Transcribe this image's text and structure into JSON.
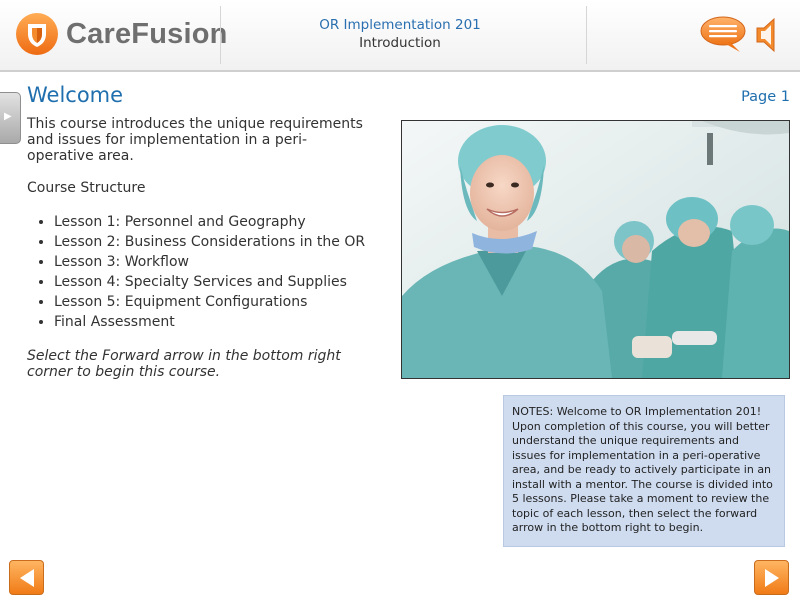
{
  "header": {
    "logo_text": "CareFusion",
    "course_title": "OR Implementation 201",
    "course_subtitle": "Introduction"
  },
  "page": {
    "title": "Welcome",
    "page_number": "Page 1"
  },
  "content": {
    "intro": "This course introduces the unique requirements and issues for implementation in a peri-operative area.",
    "structure_label": "Course Structure",
    "lessons": [
      "Lesson 1: Personnel and Geography",
      "Lesson 2: Business Considerations in the OR",
      "Lesson 3: Workflow",
      "Lesson 4: Specialty Services and Supplies",
      "Lesson 5: Equipment Configurations",
      "Final Assessment"
    ],
    "closing": "Select the Forward arrow in the bottom right corner to begin this course."
  },
  "notes": {
    "text": "NOTES: Welcome to OR Implementation 201! Upon completion of this course, you will better understand the unique requirements and issues for implementation in a peri-operative area, and be ready to actively participate in an install with a mentor. The course is divided into 5 lessons. Please take a moment to review the topic of each lesson, then select the forward arrow in the bottom right to begin."
  },
  "icons": {
    "logo": "carefusion-shield-logo",
    "notes_toggle": "speech-bubble-icon",
    "audio": "speaker-icon",
    "side_tab": "side-tab-arrow-icon",
    "back": "back-arrow-icon",
    "forward": "forward-arrow-icon"
  },
  "colors": {
    "accent_orange": "#f07b16",
    "title_blue": "#1f6fae",
    "notes_bg": "#cfdcf0"
  }
}
